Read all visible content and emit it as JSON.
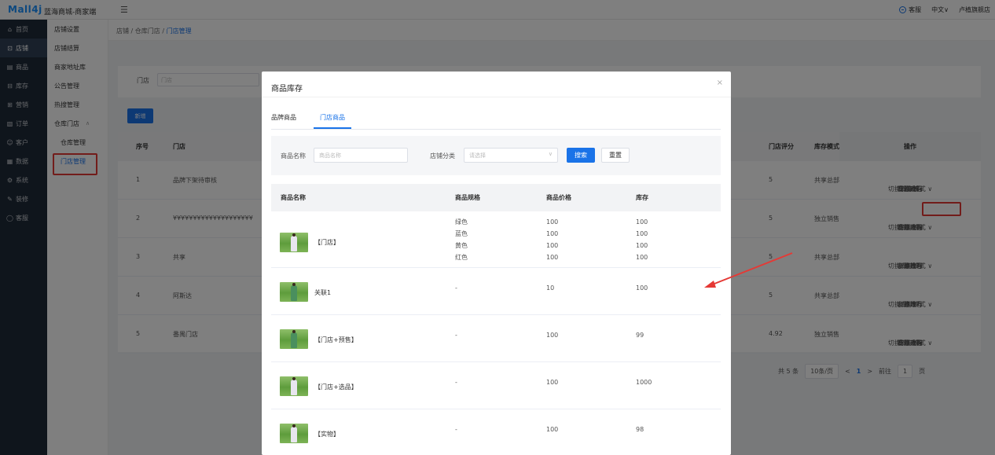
{
  "header": {
    "logo": "Mall4j",
    "title": "蓝海商城-商家端",
    "right": [
      "客服",
      "中文∨",
      "卢植旗舰店"
    ]
  },
  "sidebar_main": [
    {
      "icon": "⌂",
      "label": "首页"
    },
    {
      "icon": "⊡",
      "label": "店铺"
    },
    {
      "icon": "▤",
      "label": "商品"
    },
    {
      "icon": "⊟",
      "label": "库存"
    },
    {
      "icon": "⊞",
      "label": "营销"
    },
    {
      "icon": "▧",
      "label": "订单"
    },
    {
      "icon": "☺",
      "label": "客户"
    },
    {
      "icon": "▦",
      "label": "数据"
    },
    {
      "icon": "⚙",
      "label": "系统"
    },
    {
      "icon": "✎",
      "label": "装修"
    },
    {
      "icon": "◯",
      "label": "客服"
    }
  ],
  "sidebar_sub": [
    "店铺设置",
    "店铺结算",
    "商家地址库",
    "公告管理",
    "热搜管理",
    "仓库门店",
    "仓库管理",
    "门店管理"
  ],
  "breadcrumb": {
    "a": "店铺",
    "b": "仓库门店",
    "c": "门店管理",
    "sep": "/"
  },
  "filter": {
    "label": "门店",
    "placeholder": "门店"
  },
  "add_button": "新增",
  "store_table": {
    "headers": {
      "no": "序号",
      "store": "门店",
      "score": "门店评分",
      "mode": "库存模式",
      "ops": "操作"
    },
    "rows": [
      {
        "no": "1",
        "store": "品牌下架待审核",
        "score": "5",
        "mode": "共享总部",
        "ops1": [
          "修改",
          "重置密码",
          "商品库存"
        ],
        "ops2": [
          "切换库存模式 ∨",
          "待审核"
        ]
      },
      {
        "no": "2",
        "store": "¥¥¥¥¥¥¥¥¥¥¥¥¥¥¥¥¥¥¥¥",
        "score": "5",
        "mode": "独立销售",
        "ops1": [
          "修改",
          "重置密码",
          "商品库存"
        ],
        "ops2": [
          "切换库存模式 ∨",
          "违规下架"
        ]
      },
      {
        "no": "3",
        "store": "共享",
        "score": "5",
        "mode": "共享总部",
        "ops1": [
          "修改",
          "创建账号",
          "商品库存"
        ],
        "ops2": [
          "切换库存模式 ∨",
          "下架管理"
        ]
      },
      {
        "no": "4",
        "store": "阿斯达",
        "score": "5",
        "mode": "共享总部",
        "ops1": [
          "修改",
          "创建账号",
          "商品库存"
        ],
        "ops2": [
          "切换库存模式 ∨"
        ]
      },
      {
        "no": "5",
        "store": "番禺门店",
        "score": "4.92",
        "mode": "独立销售",
        "ops1": [
          "修改",
          "重置密码",
          "商品库存"
        ],
        "ops2": [
          "切换库存模式 ∨",
          "违规下架"
        ]
      }
    ]
  },
  "pager": {
    "total": "共 5 条",
    "size": "10条/页",
    "prev": "<",
    "page": "1",
    "next": ">",
    "goto": "前往",
    "goto_val": "1",
    "unit": "页"
  },
  "dialog": {
    "title": "商品库存",
    "close": "×",
    "tabs": [
      "品牌商品",
      "门店商品"
    ],
    "search": {
      "name_label": "商品名称",
      "name_placeholder": "商品名称",
      "cat_label": "店铺分类",
      "cat_placeholder": "请选择",
      "search_btn": "搜索",
      "reset_btn": "重置"
    },
    "table": {
      "headers": {
        "name": "商品名称",
        "spec": "商品规格",
        "price": "商品价格",
        "stock": "库存"
      },
      "rows": [
        {
          "name": "【门店】",
          "spec": [
            "绿色",
            "蓝色",
            "黄色",
            "红色"
          ],
          "price": [
            "100",
            "100",
            "100",
            "100"
          ],
          "stock": [
            "100",
            "100",
            "100",
            "100"
          ]
        },
        {
          "name": "关联1",
          "spec": [
            "-"
          ],
          "price": [
            "10"
          ],
          "stock": [
            "100"
          ]
        },
        {
          "name": "【门店+预售】",
          "spec": [
            "-"
          ],
          "price": [
            "100"
          ],
          "stock": [
            "99"
          ]
        },
        {
          "name": "【门店+选品】",
          "spec": [
            "-"
          ],
          "price": [
            "100"
          ],
          "stock": [
            "1000"
          ]
        },
        {
          "name": "【实物】",
          "spec": [
            "-"
          ],
          "price": [
            "100"
          ],
          "stock": [
            "98"
          ]
        }
      ]
    }
  },
  "colors": {
    "primary": "#1a73e8",
    "annotation": "#e53935",
    "sidebar": "#1f2a38"
  }
}
